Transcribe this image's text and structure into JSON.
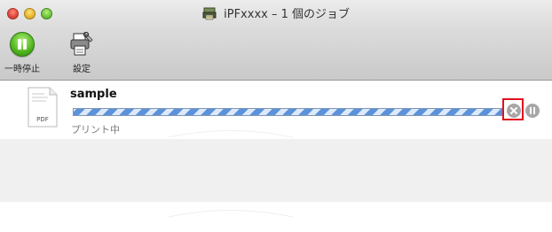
{
  "window": {
    "title": "iPFxxxx – 1 個のジョブ",
    "title_icon": "printer-app-icon"
  },
  "toolbar": {
    "pause_label": "一時停止",
    "settings_label": "設定"
  },
  "jobs": [
    {
      "name": "sample",
      "file_type": "PDF",
      "status": "プリント中",
      "progress_style": "indeterminate"
    }
  ],
  "colors": {
    "highlight": "#e01020",
    "progress_stripe": "#5c92da",
    "pause_green": "#4fb51e"
  }
}
